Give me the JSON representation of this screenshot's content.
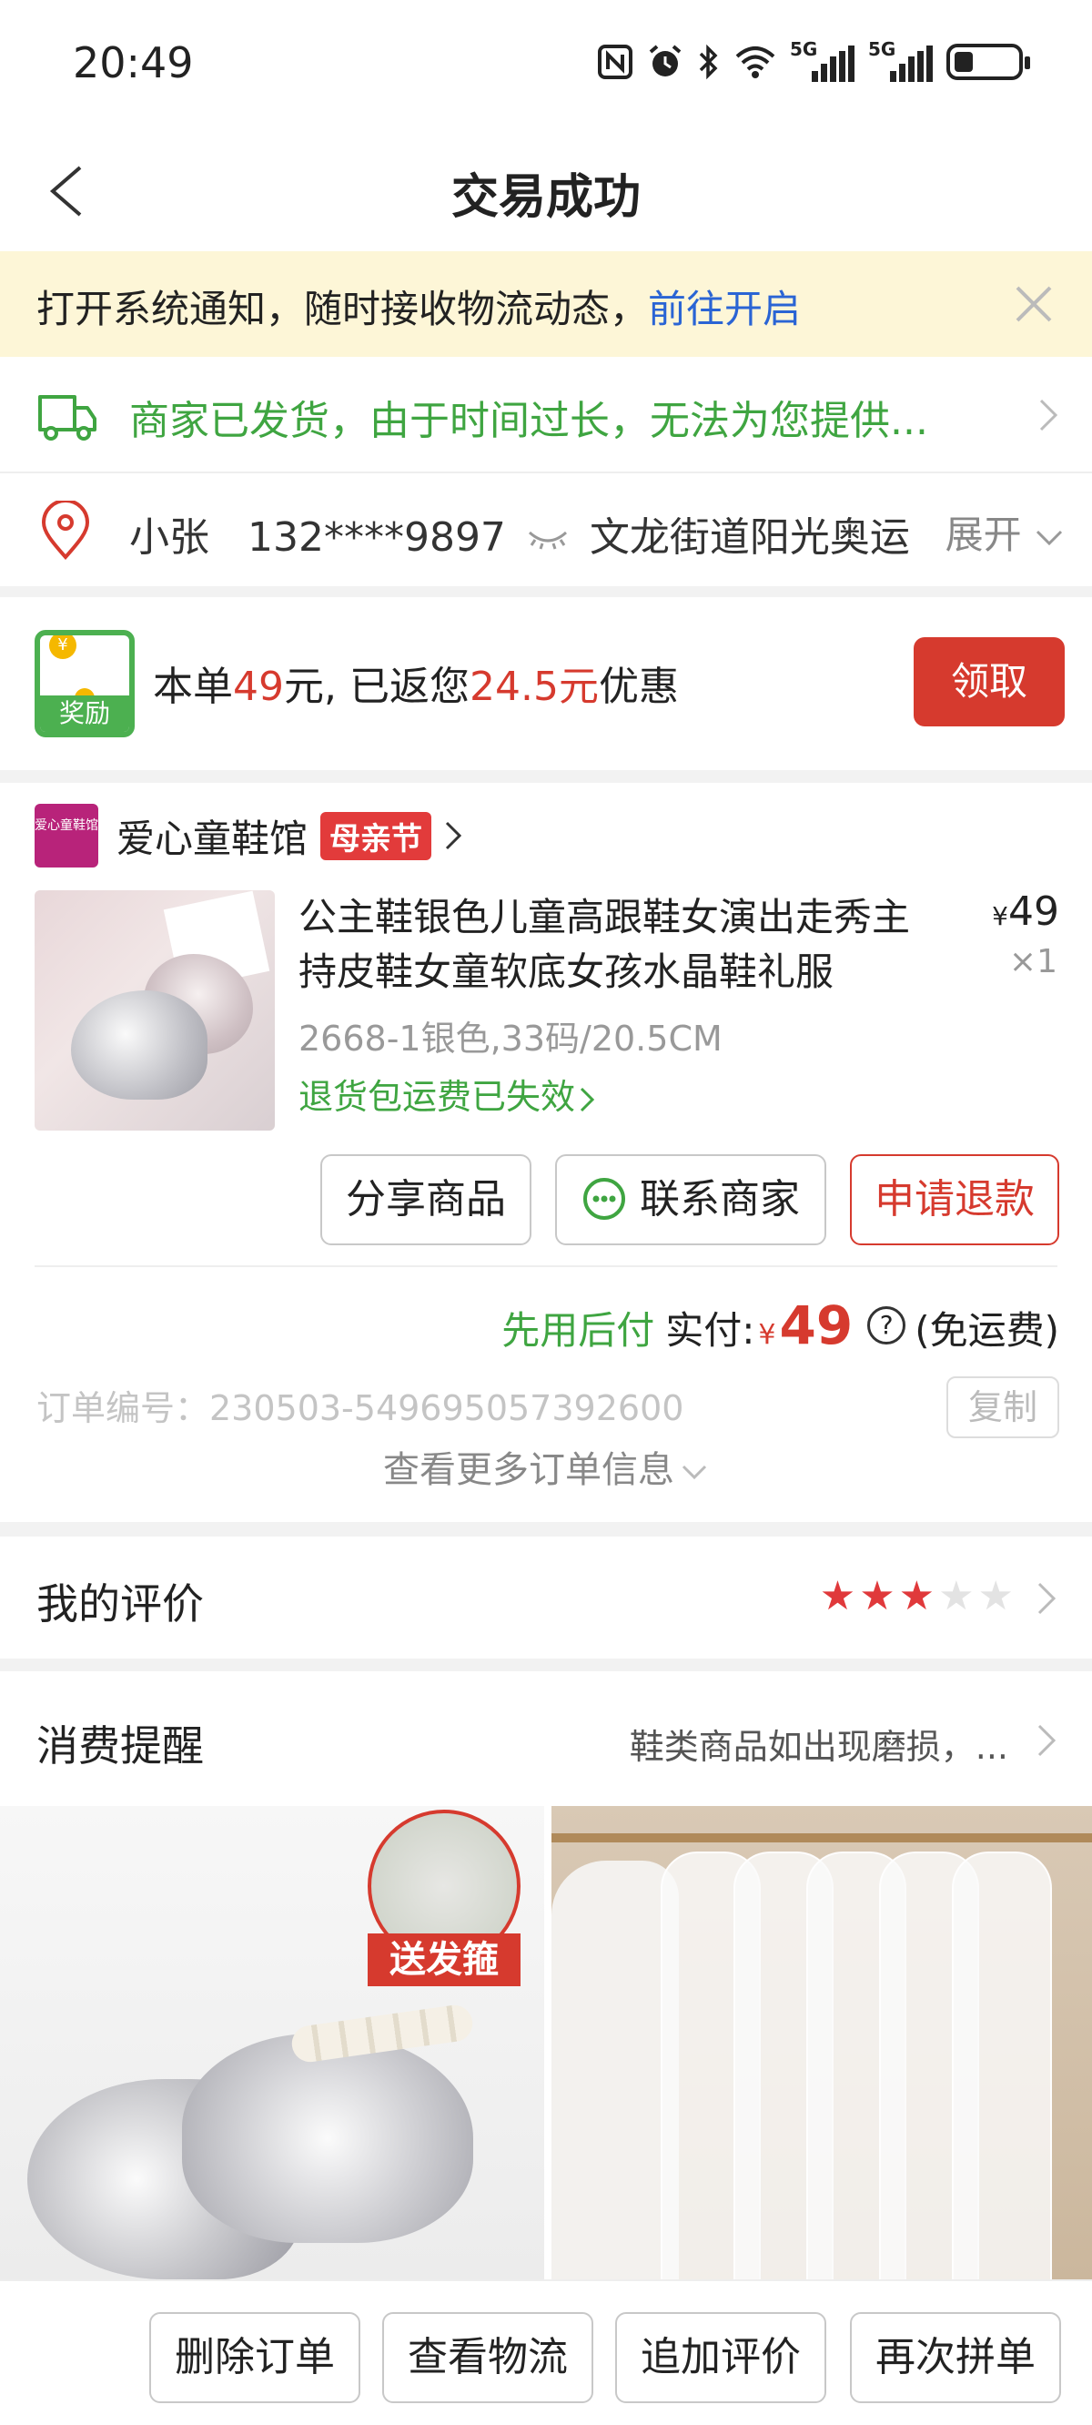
{
  "status_bar": {
    "time": "20:49",
    "icons": [
      "nfc-icon",
      "alarm-icon",
      "bluetooth-icon",
      "wifi-icon",
      "signal-5g-icon",
      "signal-5g-icon",
      "battery-icon"
    ],
    "network_labels": [
      "5G",
      "5G"
    ]
  },
  "header": {
    "title": "交易成功"
  },
  "notice": {
    "text": "打开系统通知，随时接收物流动态，",
    "link": "前往开启"
  },
  "shipping": {
    "text": "商家已发货，由于时间过长，无法为您提供..."
  },
  "address": {
    "name": "小张",
    "phone": "132****9897",
    "street": "文龙街道阳光奥运",
    "expand_label": "展开"
  },
  "reward": {
    "badge_label": "奖励",
    "text_prefix": "本单",
    "order_amount": "49",
    "text_mid": "元, 已返您",
    "returned_amount": "24.5元",
    "text_suffix": "优惠",
    "claim_label": "领取"
  },
  "shop": {
    "logo_text": "爱心童鞋馆",
    "name": "爱心童鞋馆",
    "tag": "母亲节"
  },
  "product": {
    "name": "公主鞋银色儿童高跟鞋女演出走秀主持皮鞋女童软底女孩水晶鞋礼服",
    "currency": "¥",
    "price": "49",
    "quantity": "×1",
    "spec": "2668-1银色,33码/20.5CM",
    "return_status": "退货包运费已失效"
  },
  "actions": {
    "share": "分享商品",
    "contact": "联系商家",
    "refund": "申请退款"
  },
  "payment": {
    "pay_later": "先用后付",
    "paid_label": "实付:",
    "currency": "¥",
    "amount": "49",
    "help": "?",
    "shipping_note": "(免运费)"
  },
  "order": {
    "number": "订单编号：230503-549695057392600",
    "copy_label": "复制",
    "more_label": "查看更多订单信息"
  },
  "review": {
    "label": "我的评价",
    "rating": 3,
    "max_rating": 5
  },
  "consumer_tip": {
    "label": "消费提醒",
    "value": "鞋类商品如出现磨损，..."
  },
  "recommendations": {
    "item1_badge": "送发箍"
  },
  "bottom_bar": {
    "delete": "删除订单",
    "logistics": "查看物流",
    "add_review": "追加评价",
    "reorder": "再次拼单"
  },
  "colors": {
    "accent_red": "#d63a2e",
    "green": "#3fa541",
    "link_blue": "#2a64d4",
    "notice_bg": "#fdf6d7"
  }
}
